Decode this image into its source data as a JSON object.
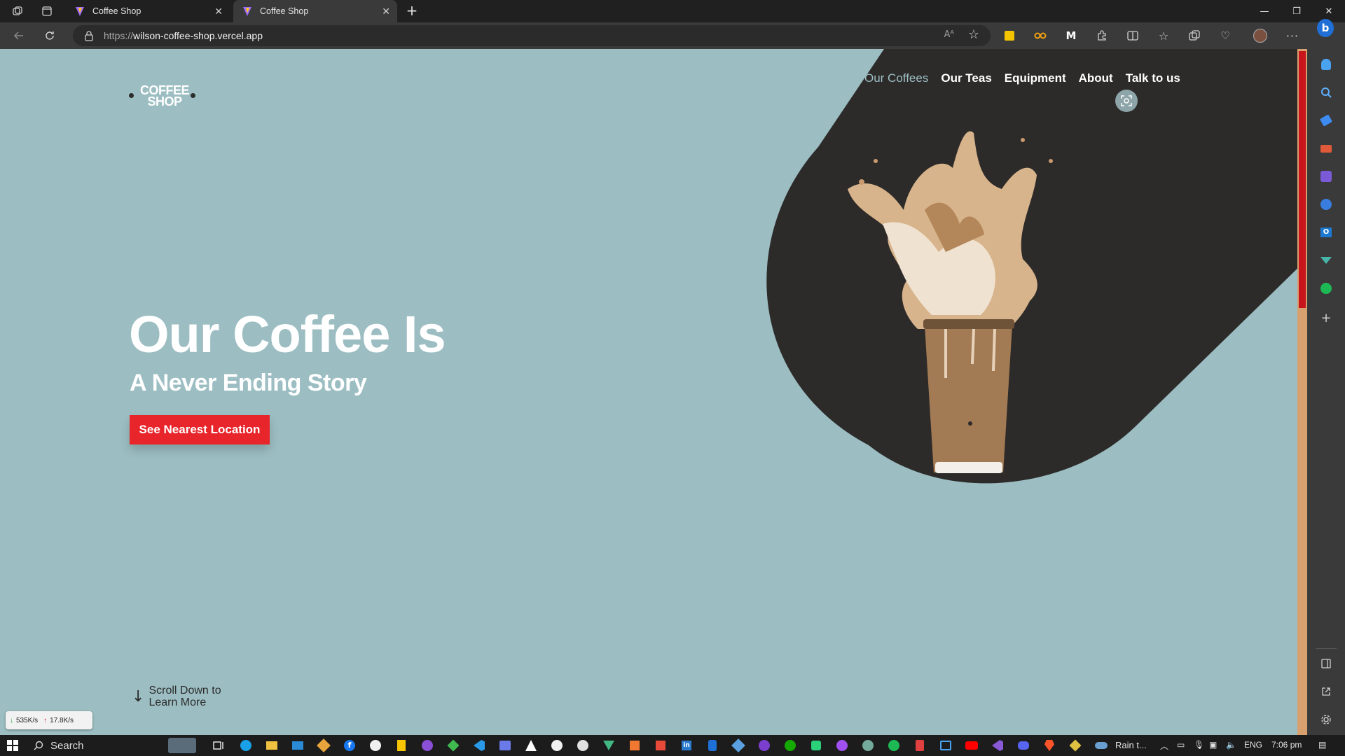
{
  "browser": {
    "tabs": [
      {
        "title": "Coffee Shop",
        "active": false
      },
      {
        "title": "Coffee Shop",
        "active": true
      }
    ],
    "url_prefix": "https://",
    "url_host": "wilson-coffee-shop.vercel.app",
    "read_aloud_label": "Aᴬ"
  },
  "site": {
    "logo_line1": "COFFEE",
    "logo_line2": "SHOP",
    "nav": [
      "Our Coffees",
      "Our Teas",
      "Equipment",
      "About",
      "Talk to us"
    ],
    "hero_title": "Our Coffee Is",
    "hero_subtitle": "A Never Ending Story",
    "cta_label": "See Nearest Location",
    "scroll_line1": "Scroll Down to",
    "scroll_line2": "Learn More",
    "colors": {
      "background": "#9cbec2",
      "blob": "#2d2b2a",
      "accent": "#e8252a"
    }
  },
  "net_monitor": {
    "down": "535K/s",
    "up": "17.8K/s"
  },
  "taskbar": {
    "search_label": "Search",
    "weather": "Rain t...",
    "language": "ENG",
    "time": "7:06 pm"
  }
}
